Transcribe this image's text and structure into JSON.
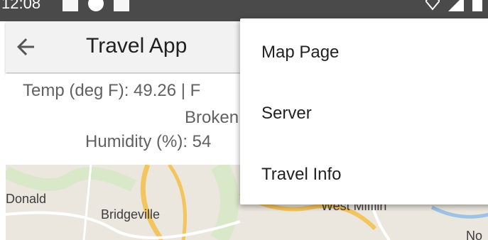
{
  "status_bar": {
    "time": "12:08"
  },
  "app_bar": {
    "title": "Travel App"
  },
  "weather": {
    "line1": "Temp (deg F): 49.26 | F",
    "line2": "Broken",
    "line3": "Humidity (%): 54"
  },
  "map": {
    "labels": [
      "Donald",
      "Bridgeville",
      "West Mifflin",
      "No"
    ]
  },
  "menu": {
    "items": [
      "Map Page",
      "Server",
      "Travel Info"
    ]
  },
  "colors": {
    "app_bar_bg": "#f2f2f2",
    "status_bar_bg": "#4a4a4a",
    "menu_bg": "#ffffff",
    "map_road": "#f3c55f"
  },
  "icons": {
    "back": "arrow-back-icon"
  }
}
